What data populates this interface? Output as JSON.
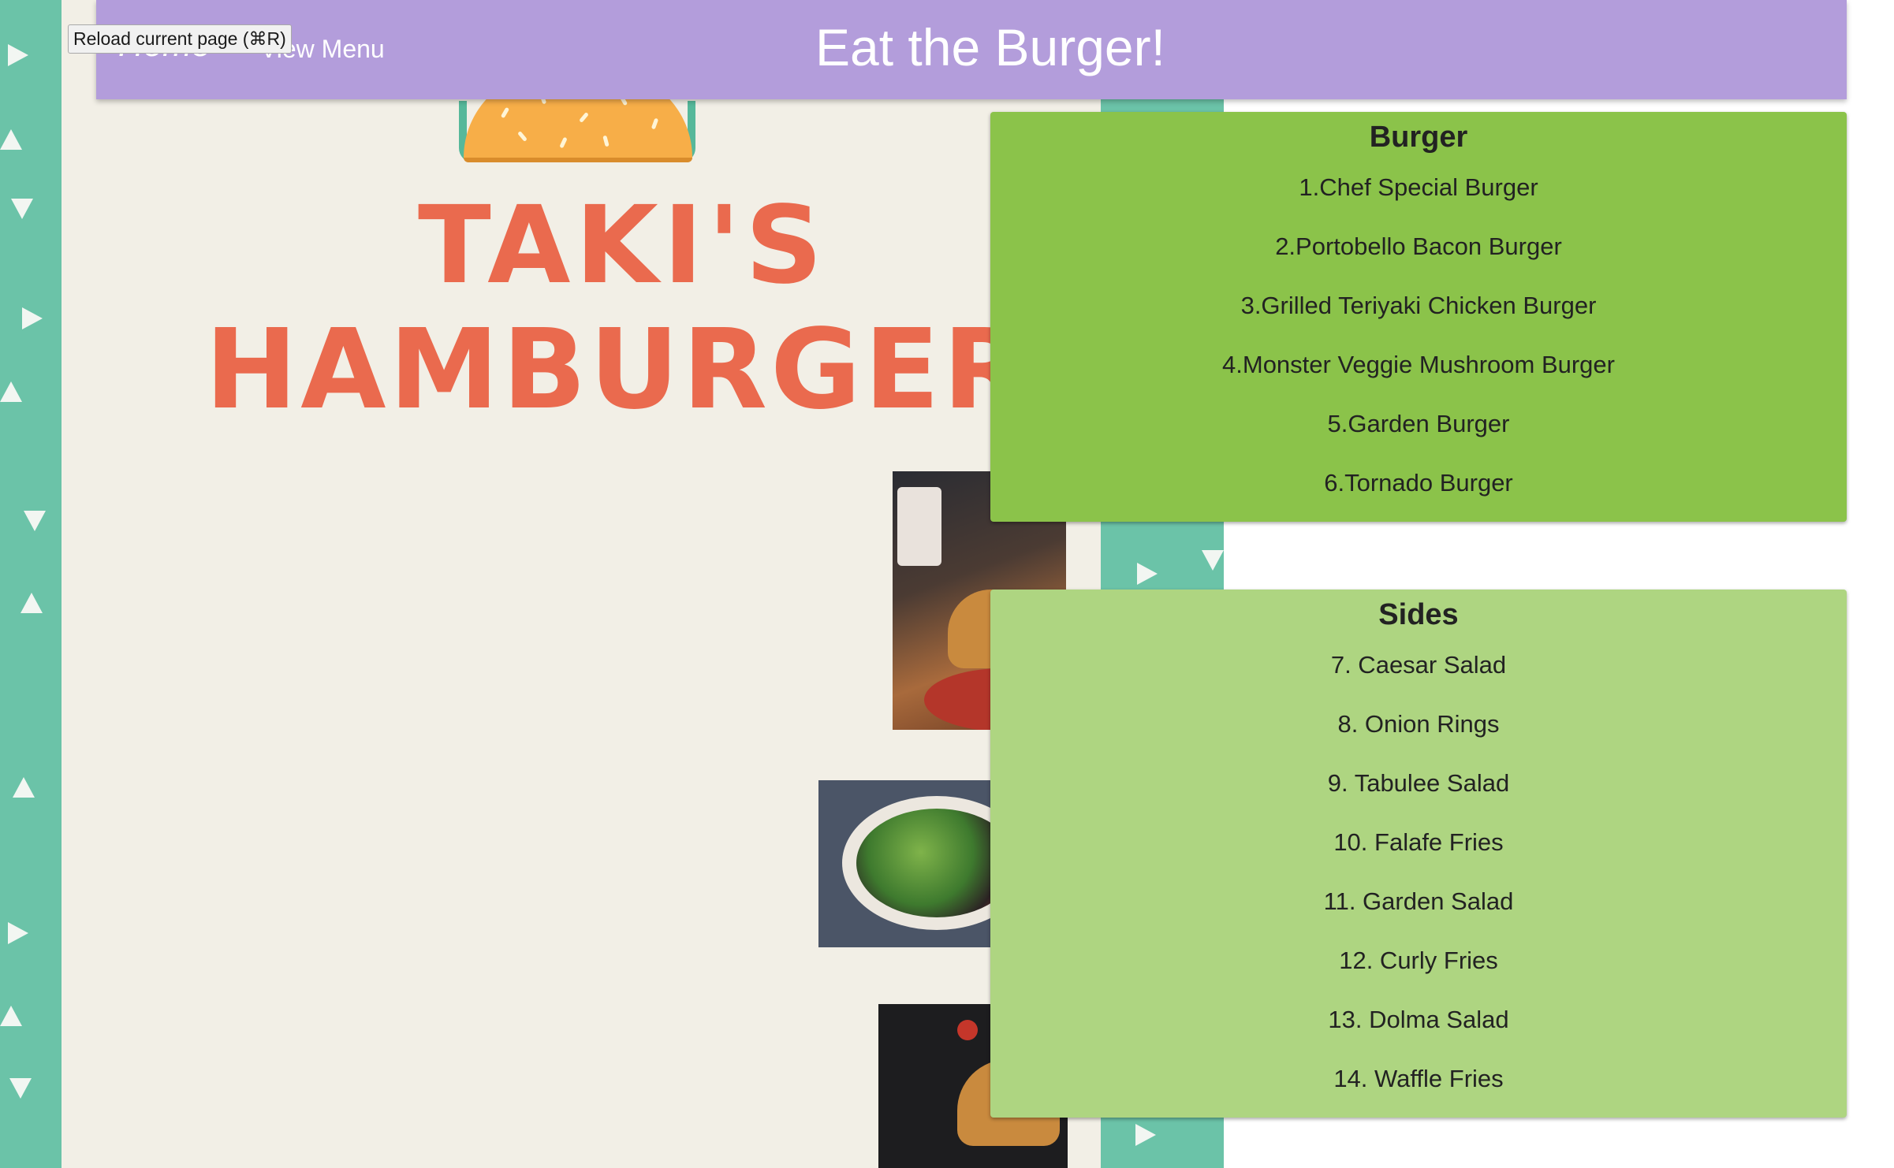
{
  "tooltip": "Reload current page (⌘R)",
  "header": {
    "home_label": "Home",
    "menu_label": "View Menu",
    "title": "Eat the Burger!"
  },
  "poster": {
    "line1": "Taki's",
    "line2": "Hamburger"
  },
  "burger_section": {
    "heading": "Burger",
    "items": [
      "1.Chef Special Burger",
      "2.Portobello Bacon Burger",
      "3.Grilled Teriyaki Chicken Burger",
      "4.Monster Veggie Mushroom Burger",
      "5.Garden Burger",
      "6.Tornado Burger"
    ]
  },
  "sides_section": {
    "heading": "Sides",
    "items": [
      "7. Caesar Salad",
      "8. Onion Rings",
      "9. Tabulee Salad",
      "10. Falafe Fries",
      "11. Garden Salad",
      "12. Curly Fries",
      "13. Dolma Salad",
      "14. Waffle Fries"
    ]
  },
  "colors": {
    "header_bg": "#b39ddb",
    "burger_panel_bg": "#8bc34a",
    "sides_panel_bg": "#aed581",
    "poster_teal": "#6bc3a8",
    "poster_text": "#ea6a4e"
  }
}
